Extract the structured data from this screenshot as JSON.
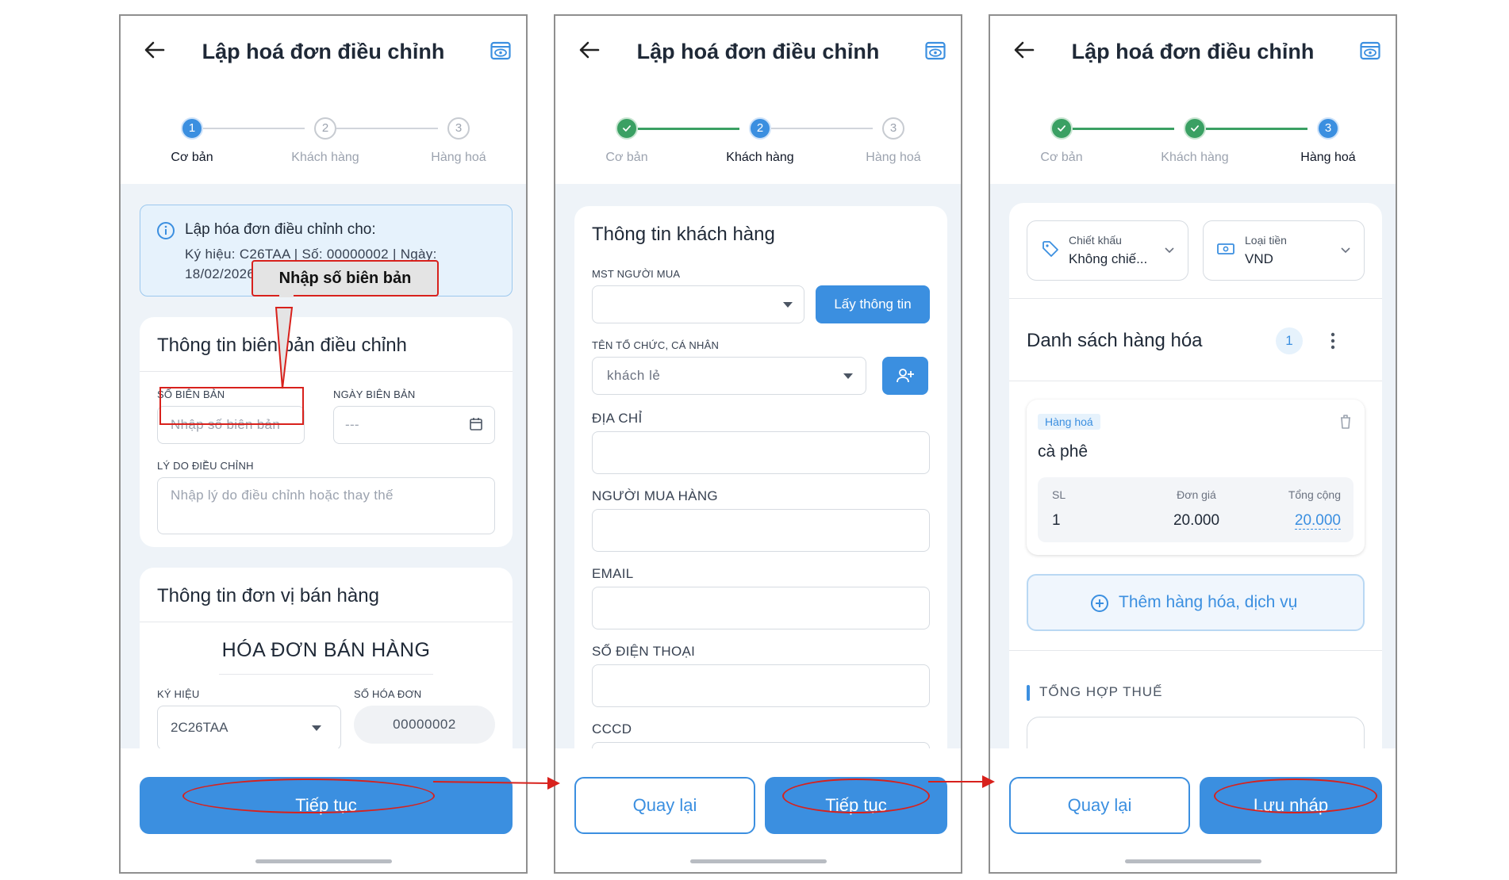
{
  "screens": [
    {
      "title": "Lập hoá đơn điều chỉnh",
      "steps": [
        "Cơ bản",
        "Khách hàng",
        "Hàng hoá"
      ],
      "active_step": 1,
      "info": {
        "heading": "Lập hóa đơn điều chỉnh cho:",
        "line1": "Ký hiệu: C26TAA | Số: 00000002 | Ngày:",
        "line2": "18/02/2026"
      },
      "callout": "Nhập số biên bản",
      "record": {
        "title": "Thông tin biên bản điều chỉnh",
        "so_bien_ban_label": "SỐ BIÊN BẢN",
        "so_bien_ban_placeholder": "Nhập số biên bản",
        "ngay_label": "NGÀY BIÊN BẢN",
        "ngay_value": "---",
        "ly_do_label": "LÝ DO ĐIỀU CHỈNH",
        "ly_do_placeholder": "Nhập lý do điều chỉnh hoặc thay thế"
      },
      "seller": {
        "title": "Thông tin đơn vị bán hàng",
        "invoice_type": "HÓA ĐƠN BÁN HÀNG",
        "ky_hieu_label": "KÝ HIỆU",
        "ky_hieu_value": "2C26TAA",
        "so_hoa_don_label": "SỐ HÓA ĐƠN",
        "so_hoa_don_value": "00000002"
      },
      "button_primary": "Tiếp tục"
    },
    {
      "title": "Lập hoá đơn điều chỉnh",
      "steps": [
        "Cơ bản",
        "Khách hàng",
        "Hàng hoá"
      ],
      "active_step": 2,
      "customer": {
        "title": "Thông tin khách hàng",
        "mst_label": "MST NGƯỜI MUA",
        "get_info_button": "Lấy thông tin",
        "org_label": "TÊN TỔ CHỨC, CÁ NHÂN",
        "org_value": "khách lẻ",
        "address_label": "ĐỊA CHỈ",
        "buyer_label": "NGƯỜI MUA HÀNG",
        "email_label": "EMAIL",
        "phone_label": "SỐ ĐIỆN THOẠI",
        "cccd_label": "CCCD"
      },
      "button_secondary": "Quay lại",
      "button_primary": "Tiếp tục"
    },
    {
      "title": "Lập hoá đơn điều chỉnh",
      "steps": [
        "Cơ bản",
        "Khách hàng",
        "Hàng hoá"
      ],
      "active_step": 3,
      "discount": {
        "label": "Chiết khấu",
        "value": "Không chiế..."
      },
      "currency": {
        "label": "Loại tiền",
        "value": "VND"
      },
      "goods": {
        "title": "Danh sách hàng hóa",
        "count": "1",
        "item": {
          "tag": "Hàng hoá",
          "name": "cà phê",
          "qty_label": "SL",
          "qty": "1",
          "price_label": "Đơn giá",
          "price": "20.000",
          "total_label": "Tổng cộng",
          "total": "20.000"
        },
        "add_button": "Thêm hàng hóa, dịch vụ"
      },
      "tax_title": "TỔNG HỢP THUẾ",
      "button_secondary": "Quay lại",
      "button_primary": "Lưu nháp"
    }
  ],
  "colors": {
    "primary": "#3b8fe0",
    "done": "#3aa063",
    "annotation": "#d8211c",
    "bg": "#eef3f8"
  }
}
